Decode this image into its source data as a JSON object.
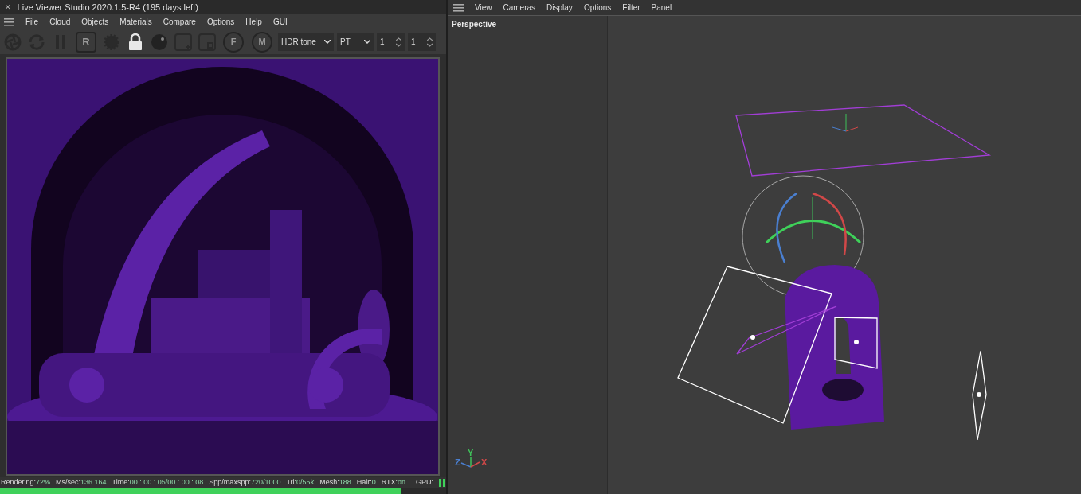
{
  "left_window": {
    "title": "Live Viewer Studio 2020.1.5-R4 (195 days left)",
    "close": "×",
    "menu": [
      "File",
      "Cloud",
      "Objects",
      "Materials",
      "Compare",
      "Options",
      "Help",
      "GUI"
    ],
    "toolbar": [
      {
        "kind": "aperture"
      },
      {
        "kind": "refresh"
      },
      {
        "kind": "pause"
      },
      {
        "kind": "letterbox",
        "label": "R"
      },
      {
        "kind": "gear"
      },
      {
        "kind": "lock"
      },
      {
        "kind": "sphere"
      },
      {
        "kind": "addbox"
      },
      {
        "kind": "smallbox"
      },
      {
        "kind": "pin",
        "label": "F"
      },
      {
        "kind": "pin",
        "label": "M"
      }
    ],
    "dropdowns": [
      "HDR tone",
      "PT"
    ],
    "spinners": [
      "1",
      "1"
    ],
    "status": [
      {
        "label": "Rendering:",
        "value": "72%"
      },
      {
        "label": "Ms/sec:",
        "value": "136.164"
      },
      {
        "label": "Time:",
        "value": "00 : 00 : 05/00 : 00 : 08"
      },
      {
        "label": "Spp/maxspp:",
        "value": "720/1000"
      },
      {
        "label": "Tri:",
        "value": "0/55k"
      },
      {
        "label": "Mesh:",
        "value": "188"
      },
      {
        "label": "Hair:",
        "value": "0"
      },
      {
        "label": "RTX:",
        "value": "on"
      },
      {
        "label": "GPU:"
      }
    ],
    "progress": {
      "level": 0.9
    }
  },
  "viewport": {
    "menu": [
      "View",
      "Cameras",
      "Display",
      "Options",
      "Filter",
      "Panel"
    ],
    "view_label": "Perspective",
    "axes": [
      {
        "axis": "Z",
        "color": "#4a7fd0"
      },
      {
        "axis": "Y",
        "color": "#3fc25a"
      },
      {
        "axis": "X",
        "color": "#d04848"
      }
    ]
  }
}
